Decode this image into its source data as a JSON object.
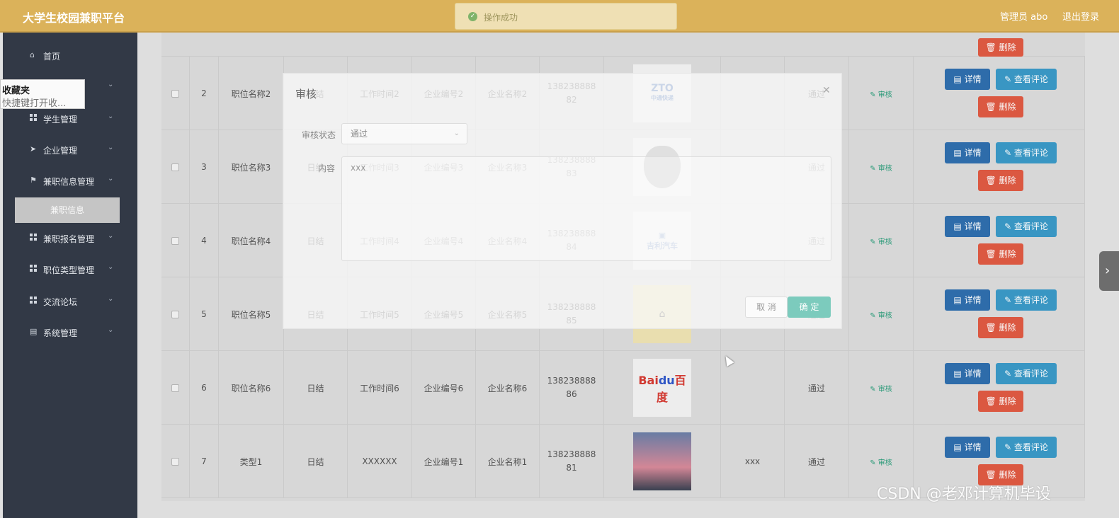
{
  "header": {
    "brand": "大学生校园兼职平台",
    "user": "管理员 abo",
    "logout": "退出登录"
  },
  "toast": {
    "text": "操作成功",
    "color": "#7fb36a"
  },
  "tooltip": {
    "title": "收藏夹",
    "hint": "快捷键打开收..."
  },
  "sidebar": {
    "items": [
      {
        "label": "首页",
        "icon": "home-icon"
      },
      {
        "label": "",
        "icon": "user-icon"
      },
      {
        "label": "学生管理",
        "icon": "grid-icon"
      },
      {
        "label": "企业管理",
        "icon": "send-icon"
      },
      {
        "label": "兼职信息管理",
        "icon": "flag-icon"
      },
      {
        "label": "兼职报名管理",
        "icon": "grid-icon"
      },
      {
        "label": "职位类型管理",
        "icon": "grid-icon"
      },
      {
        "label": "交流论坛",
        "icon": "grid-icon"
      },
      {
        "label": "系统管理",
        "icon": "clipboard-icon"
      }
    ],
    "sub_active": "兼职信息"
  },
  "table": {
    "rows": [
      {
        "no": "2",
        "name": "职位名称2",
        "pay": "日结",
        "time": "工作时间2",
        "company_no": "企业编号2",
        "company": "企业名称2",
        "phone": "13823888882",
        "logo": "zto-logo",
        "extra": "",
        "status": "通过"
      },
      {
        "no": "3",
        "name": "职位名称3",
        "pay": "日结",
        "time": "工作时间3",
        "company_no": "企业编号3",
        "company": "企业名称3",
        "phone": "13823888883",
        "logo": "apple-logo",
        "extra": "",
        "status": "通过"
      },
      {
        "no": "4",
        "name": "职位名称4",
        "pay": "日结",
        "time": "工作时间4",
        "company_no": "企业编号4",
        "company": "企业名称4",
        "phone": "13823888884",
        "logo": "geely-logo",
        "extra": "",
        "status": "通过"
      },
      {
        "no": "5",
        "name": "职位名称5",
        "pay": "日结",
        "time": "工作时间5",
        "company_no": "企业编号5",
        "company": "企业名称5",
        "phone": "13823888885",
        "logo": "calligraphy-logo",
        "extra": "",
        "status": "通过"
      },
      {
        "no": "6",
        "name": "职位名称6",
        "pay": "日结",
        "time": "工作时间6",
        "company_no": "企业编号6",
        "company": "企业名称6",
        "phone": "13823888886",
        "logo": "baidu-logo",
        "extra": "",
        "status": "通过"
      },
      {
        "no": "7",
        "name": "类型1",
        "pay": "日结",
        "time": "XXXXXX",
        "company_no": "企业编号1",
        "company": "企业名称1",
        "phone": "13823888881",
        "logo": "bridge-photo",
        "extra": "xxx",
        "status": "通过"
      }
    ],
    "audit_label": "审核",
    "detail_label": "详情",
    "review_label": "查看评论",
    "delete_label": "删除"
  },
  "modal": {
    "title": "审核",
    "status_label": "审核状态",
    "status_value": "通过",
    "content_label": "内容",
    "content_value": "xxx",
    "cancel": "取 消",
    "confirm": "确 定"
  },
  "watermark": "CSDN @老邓计算机毕设",
  "colors": {
    "header": "#dbb25a",
    "sidebar": "#333b48",
    "primary": "#2f6fae",
    "info": "#3b9ac7",
    "danger": "#e05a43",
    "success": "#2a9d7a"
  }
}
